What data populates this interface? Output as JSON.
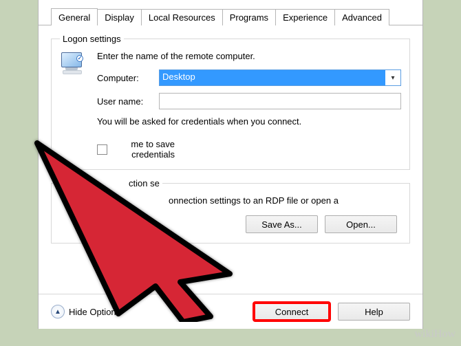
{
  "tabs": {
    "general": "General",
    "display": "Display",
    "local_resources": "Local Resources",
    "programs": "Programs",
    "experience": "Experience",
    "advanced": "Advanced"
  },
  "logon": {
    "legend": "Logon settings",
    "instruction": "Enter the name of the remote computer.",
    "computer_label": "Computer:",
    "computer_value": "Desktop",
    "username_label": "User name:",
    "username_value": "",
    "cred_hint": "You will be asked for credentials when you connect.",
    "allow_save_partial": "me to save credentials"
  },
  "conn": {
    "legend_partial": "ction se",
    "text_partial": "onnection settings to an RDP file or open a",
    "save_as": "Save As...",
    "open": "Open..."
  },
  "footer": {
    "hide_options": "Hide Options",
    "connect": "Connect",
    "help": "Help"
  },
  "watermark": "wikiHow"
}
